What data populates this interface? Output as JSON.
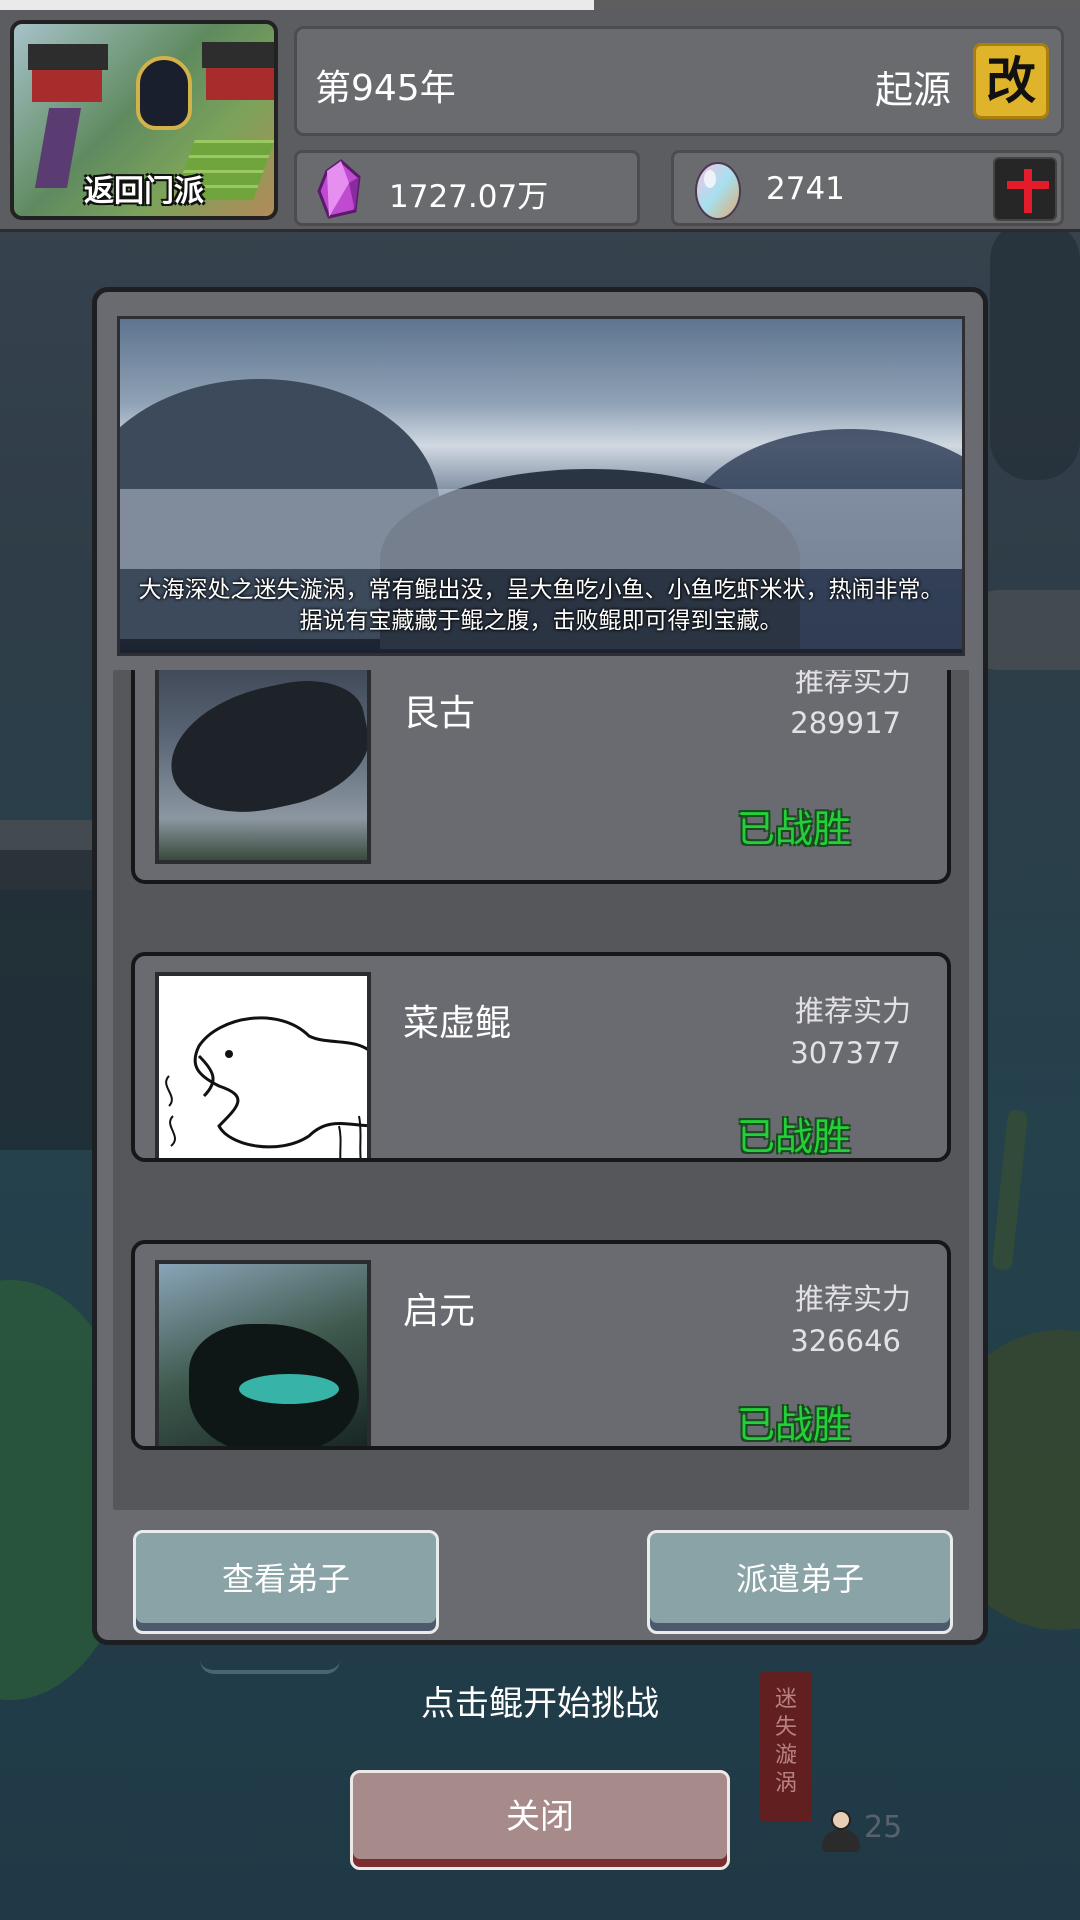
{
  "header": {
    "progress_fraction": 0.55,
    "sect_button_label": "返回门派",
    "year": "第945年",
    "origin": "起源",
    "rename_button": "改",
    "resources": {
      "spirit_stone": {
        "icon": "crystal-icon",
        "value": "1727.07万"
      },
      "egg": {
        "icon": "egg-icon",
        "value": "2741"
      }
    }
  },
  "dungeon": {
    "description": "大海深处之迷失漩涡，常有鲲出没，呈大鱼吃小鱼、小鱼吃虾米状，热闹非常。据说有宝藏藏于鲲之腹，击败鲲即可得到宝藏。",
    "bosses": [
      {
        "name": "艮古",
        "rec_label": "推荐实力",
        "rec_value": "289917",
        "status": "已战胜"
      },
      {
        "name": "菜虚鲲",
        "rec_label": "推荐实力",
        "rec_value": "307377",
        "status": "已战胜"
      },
      {
        "name": "启元",
        "rec_label": "推荐实力",
        "rec_value": "326646",
        "status": "已战胜"
      }
    ],
    "view_disciples_button": "查看弟子",
    "dispatch_disciples_button": "派遣弟子"
  },
  "footer": {
    "hint": "点击鲲开始挑战",
    "close_button": "关闭",
    "seal_text": "迷失漩涡",
    "disciple_count": "25"
  },
  "colors": {
    "victory_green": "#24d03a",
    "rename_gold": "#e0b42a",
    "plus_red": "#e41b2a"
  }
}
